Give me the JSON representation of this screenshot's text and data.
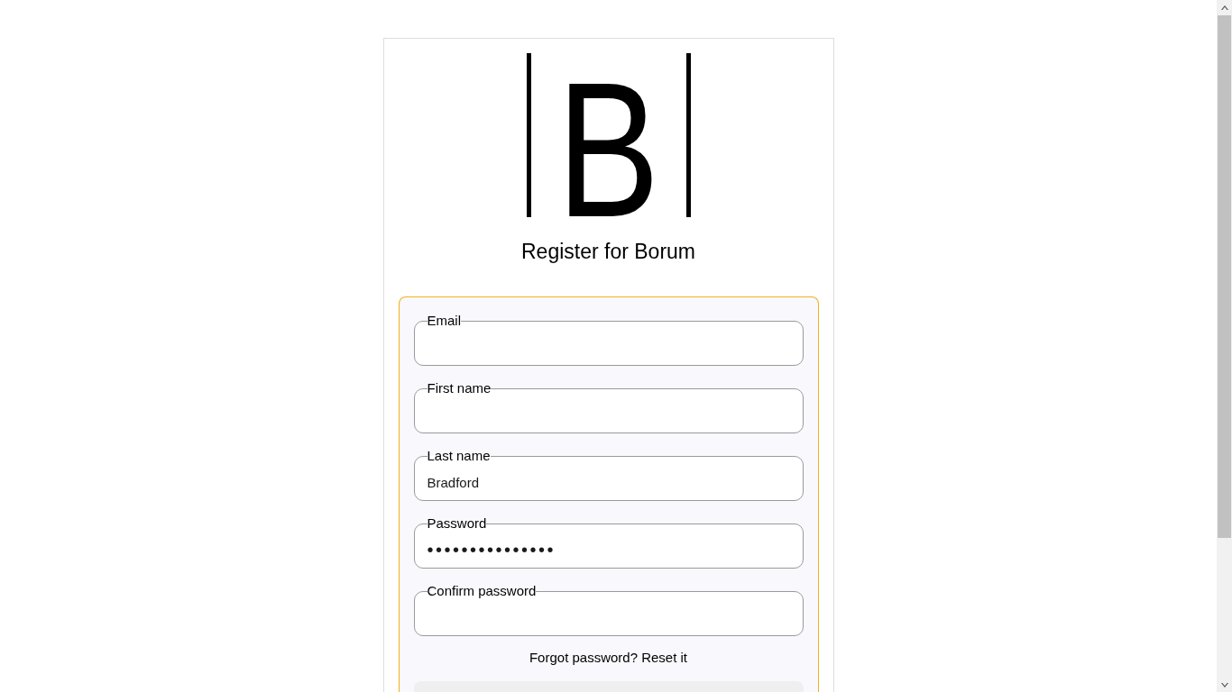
{
  "logo": {
    "text": "B"
  },
  "title": "Register for Borum",
  "form": {
    "fields": [
      {
        "label": "Email",
        "kind": "text"
      },
      {
        "label": "First name",
        "kind": "text"
      },
      {
        "label": "Last name",
        "kind": "text",
        "value": "Bradford"
      },
      {
        "label": "Password",
        "kind": "password",
        "value": "•••••••••••••••"
      },
      {
        "label": "Confirm password",
        "kind": "password"
      }
    ],
    "forgot": {
      "text": "Forgot password?",
      "link": "Reset it"
    }
  }
}
